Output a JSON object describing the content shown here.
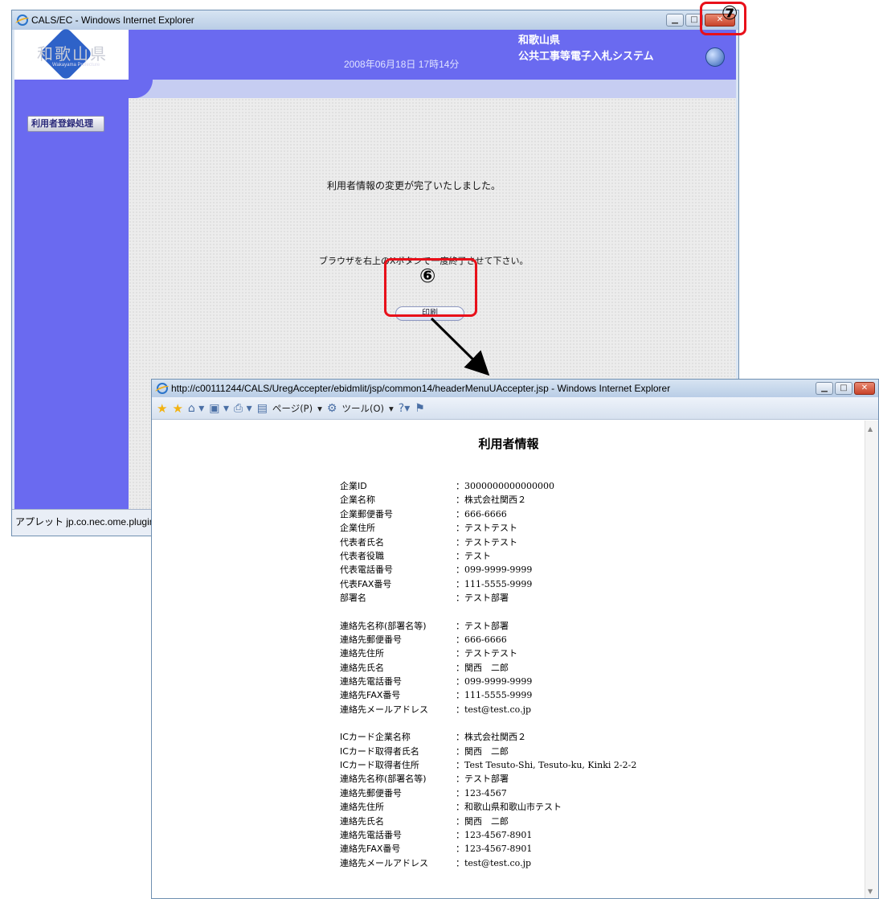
{
  "main_window": {
    "title": "CALS/EC - Windows Internet Explorer",
    "header": {
      "logo_text": "和歌山県",
      "logo_sub": "Wakayama Prefecture",
      "datetime": "2008年06月18日 17時14分",
      "prefecture": "和歌山県",
      "system_name": "公共工事等電子入札システム"
    },
    "sidebar": {
      "menu_item": "利用者登録処理"
    },
    "main": {
      "message1": "利用者情報の変更が完了いたしました。",
      "message2": "ブラウザを右上のXボタンで一度終了させて下さい。",
      "print_button": "印刷"
    },
    "status_bar": "アプレット jp.co.nec.ome.plugin.a"
  },
  "annotations": {
    "step6": "⑥",
    "step7": "⑦",
    "highlight_color": "#e8101a"
  },
  "popup_window": {
    "title": "http://c00111244/CALS/UregAccepter/ebidmlit/jsp/common14/headerMenuUAccepter.jsp - Windows Internet Explorer",
    "toolbar": {
      "page_menu": "ページ(P)",
      "tools_menu": "ツール(O)"
    },
    "document": {
      "title": "利用者情報",
      "groups": [
        [
          {
            "label": "企業ID",
            "value": "3000000000000000"
          },
          {
            "label": "企業名称",
            "value": "株式会社関西２"
          },
          {
            "label": "企業郵便番号",
            "value": "666-6666"
          },
          {
            "label": "企業住所",
            "value": "テストテスト"
          },
          {
            "label": "代表者氏名",
            "value": "テストテスト"
          },
          {
            "label": "代表者役職",
            "value": "テスト"
          },
          {
            "label": "代表電話番号",
            "value": "099-9999-9999"
          },
          {
            "label": "代表FAX番号",
            "value": "111-5555-9999"
          },
          {
            "label": "部署名",
            "value": "テスト部署"
          }
        ],
        [
          {
            "label": "連絡先名称(部署名等)",
            "value": "テスト部署"
          },
          {
            "label": "連絡先郵便番号",
            "value": "666-6666"
          },
          {
            "label": "連絡先住所",
            "value": "テストテスト"
          },
          {
            "label": "連絡先氏名",
            "value": "関西　二郎"
          },
          {
            "label": "連絡先電話番号",
            "value": "099-9999-9999"
          },
          {
            "label": "連絡先FAX番号",
            "value": "111-5555-9999"
          },
          {
            "label": "連絡先メールアドレス",
            "value": "test@test.co.jp"
          }
        ],
        [
          {
            "label": "ICカード企業名称",
            "value": "株式会社関西２"
          },
          {
            "label": "ICカード取得者氏名",
            "value": "関西　二郎"
          },
          {
            "label": "ICカード取得者住所",
            "value": "Test Tesuto-Shi, Tesuto-ku, Kinki 2-2-2"
          },
          {
            "label": "連絡先名称(部署名等)",
            "value": "テスト部署"
          },
          {
            "label": "連絡先郵便番号",
            "value": "123-4567"
          },
          {
            "label": "連絡先住所",
            "value": "和歌山県和歌山市テスト"
          },
          {
            "label": "連絡先氏名",
            "value": "関西　二郎"
          },
          {
            "label": "連絡先電話番号",
            "value": "123-4567-8901"
          },
          {
            "label": "連絡先FAX番号",
            "value": "123-4567-8901"
          },
          {
            "label": "連絡先メールアドレス",
            "value": "test@test.co.jp"
          }
        ]
      ]
    }
  }
}
